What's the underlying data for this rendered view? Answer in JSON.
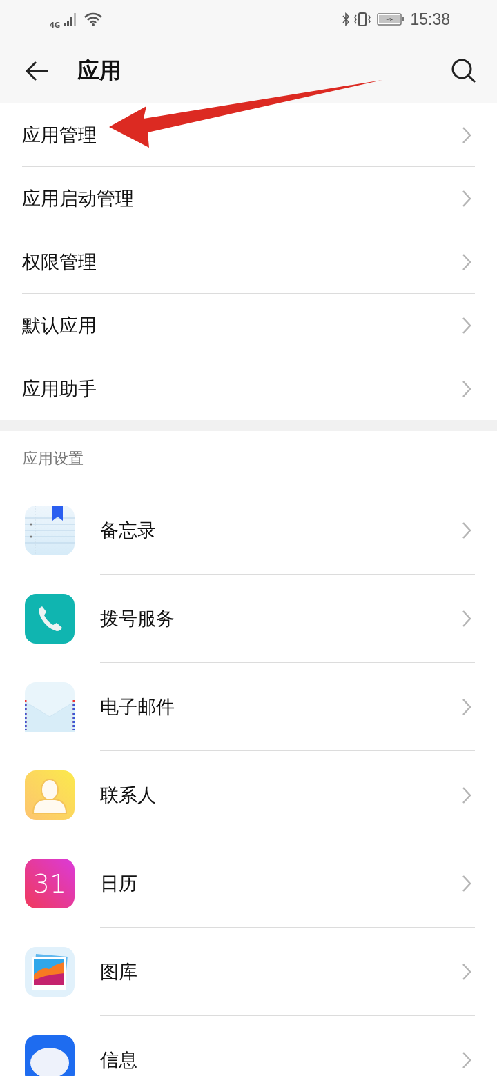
{
  "status_bar": {
    "network": "4G",
    "time": "15:38"
  },
  "header": {
    "title": "应用"
  },
  "menu_items": [
    {
      "label": "应用管理",
      "highlighted": true
    },
    {
      "label": "应用启动管理",
      "highlighted": false
    },
    {
      "label": "权限管理",
      "highlighted": false
    },
    {
      "label": "默认应用",
      "highlighted": false
    },
    {
      "label": "应用助手",
      "highlighted": false
    }
  ],
  "section": {
    "title": "应用设置"
  },
  "apps": [
    {
      "kind": "notes",
      "label": "备忘录"
    },
    {
      "kind": "dialer",
      "label": "拨号服务"
    },
    {
      "kind": "mail",
      "label": "电子邮件"
    },
    {
      "kind": "contacts",
      "label": "联系人"
    },
    {
      "kind": "calendar",
      "label": "日历",
      "icon_text": "31"
    },
    {
      "kind": "gallery",
      "label": "图库"
    },
    {
      "kind": "messages",
      "label": "信息"
    }
  ]
}
